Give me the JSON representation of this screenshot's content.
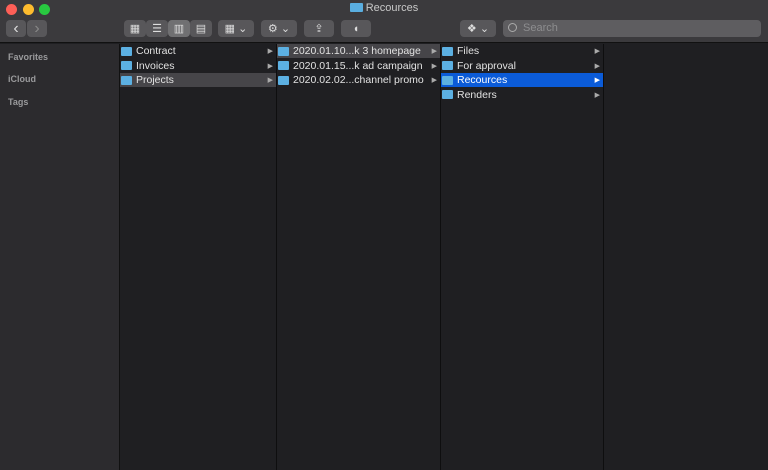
{
  "window": {
    "title": "Recources",
    "colors": {
      "close": "#fe5f57",
      "minimize": "#febc2e",
      "zoom": "#28c840",
      "accent": "#0b5bd8",
      "folder": "#5cb0e2"
    }
  },
  "toolbar": {
    "back": "‹",
    "forward": "›",
    "search_placeholder": "Search",
    "icons": [
      "icon-view",
      "list-view",
      "column-view",
      "gallery-view",
      "group-menu",
      "action-gear",
      "share",
      "tag",
      "dropbox"
    ]
  },
  "sidebar": {
    "sections": [
      "Favorites",
      "iCloud",
      "Tags"
    ]
  },
  "columns": [
    [
      {
        "name": "Contract"
      },
      {
        "name": "Invoices"
      },
      {
        "name": "Projects",
        "selected": "inactive"
      }
    ],
    [
      {
        "name": "2020.01.10...k  3 homepage",
        "selected": "inactive"
      },
      {
        "name": "2020.01.15...k ad campaign"
      },
      {
        "name": "2020.02.02...channel promo"
      }
    ],
    [
      {
        "name": "Files"
      },
      {
        "name": "For approval"
      },
      {
        "name": "Recources",
        "selected": "active"
      },
      {
        "name": "Renders"
      }
    ]
  ]
}
